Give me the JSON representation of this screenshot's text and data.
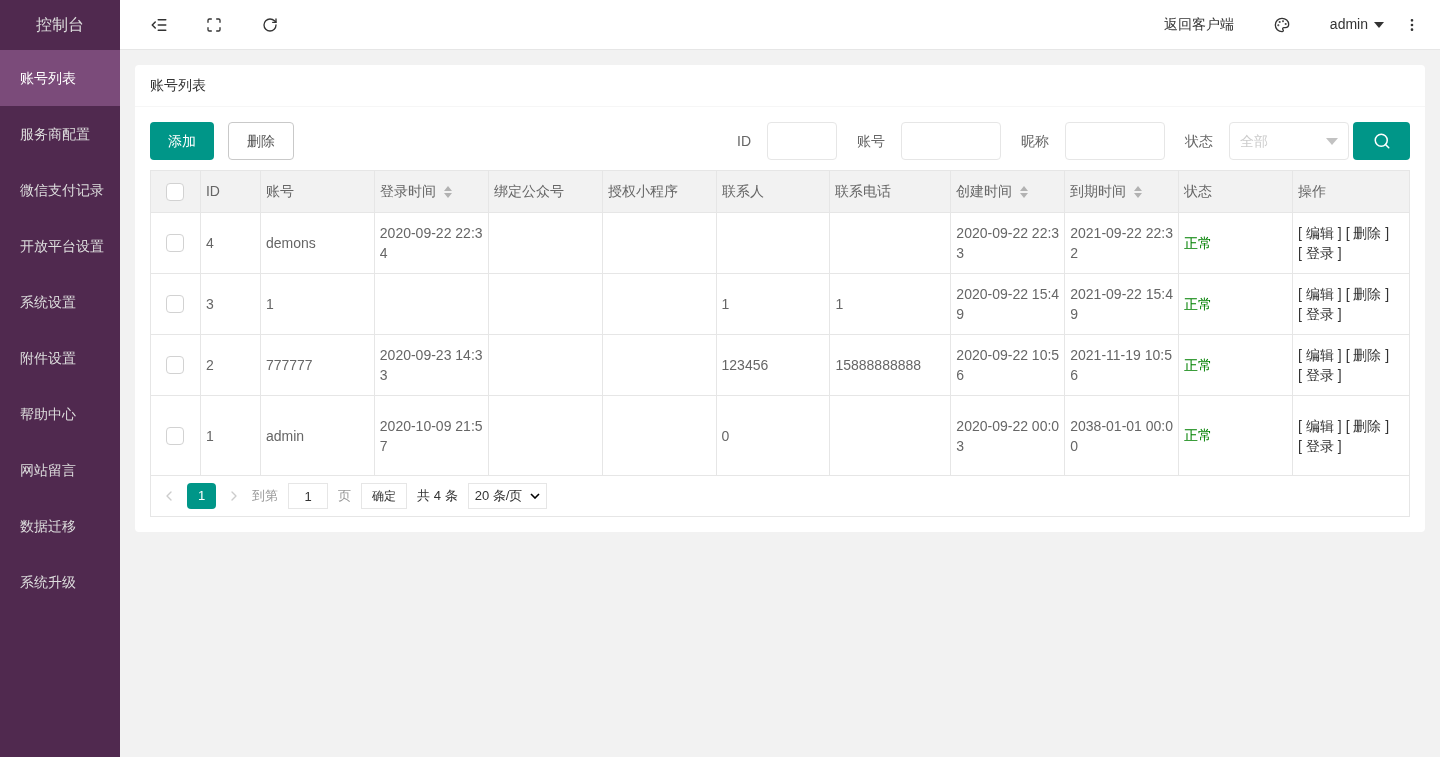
{
  "sidebar": {
    "title": "控制台",
    "items": [
      {
        "label": "账号列表",
        "selected": true
      },
      {
        "label": "服务商配置",
        "selected": false
      },
      {
        "label": "微信支付记录",
        "selected": false
      },
      {
        "label": "开放平台设置",
        "selected": false
      },
      {
        "label": "系统设置",
        "selected": false
      },
      {
        "label": "附件设置",
        "selected": false
      },
      {
        "label": "帮助中心",
        "selected": false
      },
      {
        "label": "网站留言",
        "selected": false
      },
      {
        "label": "数据迁移",
        "selected": false
      },
      {
        "label": "系统升级",
        "selected": false
      }
    ]
  },
  "topbar": {
    "client_link": "返回客户端",
    "user": "admin"
  },
  "card": {
    "title": "账号列表"
  },
  "toolbar": {
    "add": "添加",
    "delete": "删除"
  },
  "filters": [
    {
      "label": "ID",
      "kind": "input"
    },
    {
      "label": "账号",
      "kind": "input"
    },
    {
      "label": "昵称",
      "kind": "input"
    },
    {
      "label": "状态",
      "kind": "select",
      "placeholder": "全部"
    }
  ],
  "table": {
    "header_checked": false,
    "columns": [
      {
        "label": "ID",
        "sortable": false
      },
      {
        "label": "账号",
        "sortable": false
      },
      {
        "label": "登录时间",
        "sortable": true
      },
      {
        "label": "绑定公众号",
        "sortable": false
      },
      {
        "label": "授权小程序",
        "sortable": false
      },
      {
        "label": "联系人",
        "sortable": false
      },
      {
        "label": "联系电话",
        "sortable": false
      },
      {
        "label": "创建时间",
        "sortable": true
      },
      {
        "label": "到期时间",
        "sortable": true
      },
      {
        "label": "状态",
        "sortable": false
      },
      {
        "label": "操作",
        "sortable": false
      }
    ],
    "rows": [
      {
        "checked": false,
        "cells": [
          "4",
          "demons",
          "2020-09-22 22:34",
          "",
          "",
          "",
          "",
          "2020-09-22 22:33",
          "2021-09-22 22:32"
        ],
        "status": "正常",
        "actions": [
          "[ 编辑 ]",
          "[ 删除 ]",
          "[ 登录 ]"
        ]
      },
      {
        "checked": false,
        "cells": [
          "3",
          "1",
          "",
          "",
          "",
          "1",
          "1",
          "2020-09-22 15:49",
          "2021-09-22 15:49"
        ],
        "status": "正常",
        "actions": [
          "[ 编辑 ]",
          "[ 删除 ]",
          "[ 登录 ]"
        ]
      },
      {
        "checked": false,
        "cells": [
          "2",
          "777777",
          "2020-09-23 14:33",
          "",
          "",
          "123456",
          "15888888888",
          "2020-09-22 10:56",
          "2021-11-19 10:56"
        ],
        "status": "正常",
        "actions": [
          "[ 编辑 ]",
          "[ 删除 ]",
          "[ 登录 ]"
        ]
      },
      {
        "checked": false,
        "cells": [
          "1",
          "admin",
          "2020-10-09 21:57",
          "",
          "",
          "0",
          "",
          "2020-09-22 00:03",
          "2038-01-01 00:00"
        ],
        "status": "正常",
        "actions": [
          "[ 编辑 ]",
          "[ 删除 ]",
          "[ 登录 ]"
        ]
      }
    ]
  },
  "pagination": {
    "pages": [
      {
        "label": "1",
        "selected": true
      }
    ],
    "goto_label": "到第",
    "goto_value": "1",
    "page_unit": "页",
    "confirm": "确定",
    "total": "共 4 条",
    "page_size": "20 条/页"
  }
}
